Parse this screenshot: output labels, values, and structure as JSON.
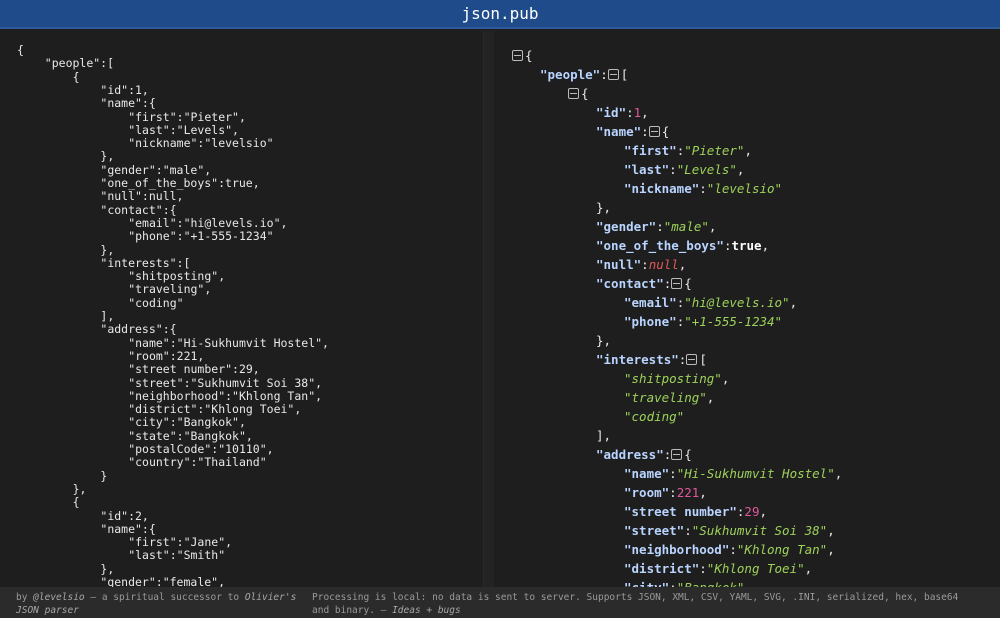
{
  "title": "json.pub",
  "left_lines": [
    [
      0,
      "{"
    ],
    [
      1,
      "\"people\":["
    ],
    [
      2,
      "{"
    ],
    [
      3,
      "\"id\":1,"
    ],
    [
      3,
      "\"name\":{"
    ],
    [
      4,
      "\"first\":\"Pieter\","
    ],
    [
      4,
      "\"last\":\"Levels\","
    ],
    [
      4,
      "\"nickname\":\"levelsio\""
    ],
    [
      3,
      "},"
    ],
    [
      3,
      "\"gender\":\"male\","
    ],
    [
      3,
      "\"one_of_the_boys\":true,"
    ],
    [
      3,
      "\"null\":null,"
    ],
    [
      3,
      "\"contact\":{"
    ],
    [
      4,
      "\"email\":\"hi@levels.io\","
    ],
    [
      4,
      "\"phone\":\"+1-555-1234\""
    ],
    [
      3,
      "},"
    ],
    [
      3,
      "\"interests\":["
    ],
    [
      4,
      "\"shitposting\","
    ],
    [
      4,
      "\"traveling\","
    ],
    [
      4,
      "\"coding\""
    ],
    [
      3,
      "],"
    ],
    [
      3,
      "\"address\":{"
    ],
    [
      4,
      "\"name\":\"Hi-Sukhumvit Hostel\","
    ],
    [
      4,
      "\"room\":221,"
    ],
    [
      4,
      "\"street number\":29,"
    ],
    [
      4,
      "\"street\":\"Sukhumvit Soi 38\","
    ],
    [
      4,
      "\"neighborhood\":\"Khlong Tan\","
    ],
    [
      4,
      "\"district\":\"Khlong Toei\","
    ],
    [
      4,
      "\"city\":\"Bangkok\","
    ],
    [
      4,
      "\"state\":\"Bangkok\","
    ],
    [
      4,
      "\"postalCode\":\"10110\","
    ],
    [
      4,
      "\"country\":\"Thailand\""
    ],
    [
      3,
      "}"
    ],
    [
      2,
      "},"
    ],
    [
      2,
      "{"
    ],
    [
      3,
      "\"id\":2,"
    ],
    [
      3,
      "\"name\":{"
    ],
    [
      4,
      "\"first\":\"Jane\","
    ],
    [
      4,
      "\"last\":\"Smith\""
    ],
    [
      3,
      "},"
    ],
    [
      3,
      "\"gender\":\"female\","
    ]
  ],
  "right_lines": [
    [
      0,
      [
        [
          "T",
          ""
        ],
        [
          "p",
          "{"
        ]
      ]
    ],
    [
      1,
      [
        [
          "k",
          "\"people\""
        ],
        [
          "p",
          ":"
        ],
        [
          "T",
          ""
        ],
        [
          "p",
          "["
        ]
      ]
    ],
    [
      2,
      [
        [
          "T",
          ""
        ],
        [
          "p",
          "{"
        ]
      ]
    ],
    [
      3,
      [
        [
          "k",
          "\"id\""
        ],
        [
          "p",
          ":"
        ],
        [
          "n",
          "1"
        ],
        [
          "p",
          ","
        ]
      ]
    ],
    [
      3,
      [
        [
          "k",
          "\"name\""
        ],
        [
          "p",
          ":"
        ],
        [
          "T",
          ""
        ],
        [
          "p",
          "{"
        ]
      ]
    ],
    [
      4,
      [
        [
          "k",
          "\"first\""
        ],
        [
          "p",
          ":"
        ],
        [
          "s",
          "\"Pieter\""
        ],
        [
          "p",
          ","
        ]
      ]
    ],
    [
      4,
      [
        [
          "k",
          "\"last\""
        ],
        [
          "p",
          ":"
        ],
        [
          "s",
          "\"Levels\""
        ],
        [
          "p",
          ","
        ]
      ]
    ],
    [
      4,
      [
        [
          "k",
          "\"nickname\""
        ],
        [
          "p",
          ":"
        ],
        [
          "s",
          "\"levelsio\""
        ]
      ]
    ],
    [
      3,
      [
        [
          "p",
          "},"
        ]
      ]
    ],
    [
      3,
      [
        [
          "k",
          "\"gender\""
        ],
        [
          "p",
          ":"
        ],
        [
          "s",
          "\"male\""
        ],
        [
          "p",
          ","
        ]
      ]
    ],
    [
      3,
      [
        [
          "k",
          "\"one_of_the_boys\""
        ],
        [
          "p",
          ":"
        ],
        [
          "b",
          "true"
        ],
        [
          "p",
          ","
        ]
      ]
    ],
    [
      3,
      [
        [
          "k",
          "\"null\""
        ],
        [
          "p",
          ":"
        ],
        [
          "nl",
          "null"
        ],
        [
          "p",
          ","
        ]
      ]
    ],
    [
      3,
      [
        [
          "k",
          "\"contact\""
        ],
        [
          "p",
          ":"
        ],
        [
          "T",
          ""
        ],
        [
          "p",
          "{"
        ]
      ]
    ],
    [
      4,
      [
        [
          "k",
          "\"email\""
        ],
        [
          "p",
          ":"
        ],
        [
          "s",
          "\"hi@levels.io\""
        ],
        [
          "p",
          ","
        ]
      ]
    ],
    [
      4,
      [
        [
          "k",
          "\"phone\""
        ],
        [
          "p",
          ":"
        ],
        [
          "s",
          "\"+1-555-1234\""
        ]
      ]
    ],
    [
      3,
      [
        [
          "p",
          "},"
        ]
      ]
    ],
    [
      3,
      [
        [
          "k",
          "\"interests\""
        ],
        [
          "p",
          ":"
        ],
        [
          "T",
          ""
        ],
        [
          "p",
          "["
        ]
      ]
    ],
    [
      4,
      [
        [
          "s",
          "\"shitposting\""
        ],
        [
          "p",
          ","
        ]
      ]
    ],
    [
      4,
      [
        [
          "s",
          "\"traveling\""
        ],
        [
          "p",
          ","
        ]
      ]
    ],
    [
      4,
      [
        [
          "s",
          "\"coding\""
        ]
      ]
    ],
    [
      3,
      [
        [
          "p",
          "],"
        ]
      ]
    ],
    [
      3,
      [
        [
          "k",
          "\"address\""
        ],
        [
          "p",
          ":"
        ],
        [
          "T",
          ""
        ],
        [
          "p",
          "{"
        ]
      ]
    ],
    [
      4,
      [
        [
          "k",
          "\"name\""
        ],
        [
          "p",
          ":"
        ],
        [
          "s",
          "\"Hi-Sukhumvit Hostel\""
        ],
        [
          "p",
          ","
        ]
      ]
    ],
    [
      4,
      [
        [
          "k",
          "\"room\""
        ],
        [
          "p",
          ":"
        ],
        [
          "n",
          "221"
        ],
        [
          "p",
          ","
        ]
      ]
    ],
    [
      4,
      [
        [
          "k",
          "\"street number\""
        ],
        [
          "p",
          ":"
        ],
        [
          "n",
          "29"
        ],
        [
          "p",
          ","
        ]
      ]
    ],
    [
      4,
      [
        [
          "k",
          "\"street\""
        ],
        [
          "p",
          ":"
        ],
        [
          "s",
          "\"Sukhumvit Soi 38\""
        ],
        [
          "p",
          ","
        ]
      ]
    ],
    [
      4,
      [
        [
          "k",
          "\"neighborhood\""
        ],
        [
          "p",
          ":"
        ],
        [
          "s",
          "\"Khlong Tan\""
        ],
        [
          "p",
          ","
        ]
      ]
    ],
    [
      4,
      [
        [
          "k",
          "\"district\""
        ],
        [
          "p",
          ":"
        ],
        [
          "s",
          "\"Khlong Toei\""
        ],
        [
          "p",
          ","
        ]
      ]
    ],
    [
      4,
      [
        [
          "k",
          "\"city\""
        ],
        [
          "p",
          ":"
        ],
        [
          "s",
          "\"Bangkok\""
        ],
        [
          "p",
          ","
        ]
      ]
    ]
  ],
  "footer": {
    "by": "by ",
    "author": "@levelsio",
    "mid": " – a spiritual successor to ",
    "link": "Olivier's JSON parser",
    "info": "Processing is local: no data is sent to server. Supports JSON, XML, CSV, YAML, SVG, .INI, serialized, hex, base64 and binary. – ",
    "ideas": "Ideas + bugs"
  }
}
